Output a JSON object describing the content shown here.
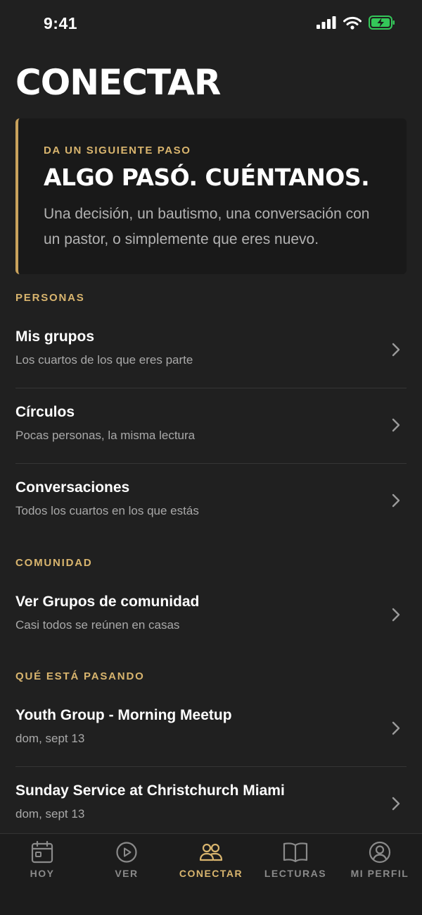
{
  "status_bar": {
    "time": "9:41"
  },
  "page": {
    "title": "CONECTAR"
  },
  "cta": {
    "eyebrow": "DA UN SIGUIENTE PASO",
    "title": "ALGO PASÓ. CUÉNTANOS.",
    "body": "Una decisión, un bautismo, una conversación con un pastor, o simplemente que eres nuevo."
  },
  "sections": {
    "personas": {
      "header": "PERSONAS",
      "items": [
        {
          "title": "Mis grupos",
          "subtitle": "Los cuartos de los que eres parte"
        },
        {
          "title": "Círculos",
          "subtitle": "Pocas personas, la misma lectura"
        },
        {
          "title": "Conversaciones",
          "subtitle": "Todos los cuartos en los que estás"
        }
      ]
    },
    "comunidad": {
      "header": "COMUNIDAD",
      "items": [
        {
          "title": "Ver Grupos de comunidad",
          "subtitle": "Casi todos se reúnen en casas"
        }
      ]
    },
    "pasando": {
      "header": "QUÉ ESTÁ PASANDO",
      "items": [
        {
          "title": "Youth Group - Morning Meetup",
          "subtitle": "dom, sept 13"
        },
        {
          "title": "Sunday Service at Christchurch Miami",
          "subtitle": "dom, sept 13"
        }
      ]
    }
  },
  "tab_bar": {
    "tabs": [
      {
        "label": "HOY",
        "icon": "calendar-icon",
        "active": false
      },
      {
        "label": "VER",
        "icon": "play-circle-icon",
        "active": false
      },
      {
        "label": "CONECTAR",
        "icon": "people-icon",
        "active": true
      },
      {
        "label": "LECTURAS",
        "icon": "book-icon",
        "active": false
      },
      {
        "label": "MI PERFIL",
        "icon": "profile-icon",
        "active": false
      }
    ]
  },
  "colors": {
    "background": "#202020",
    "accent": "#d9b56e",
    "card": "#191919",
    "battery": "#34c759"
  }
}
